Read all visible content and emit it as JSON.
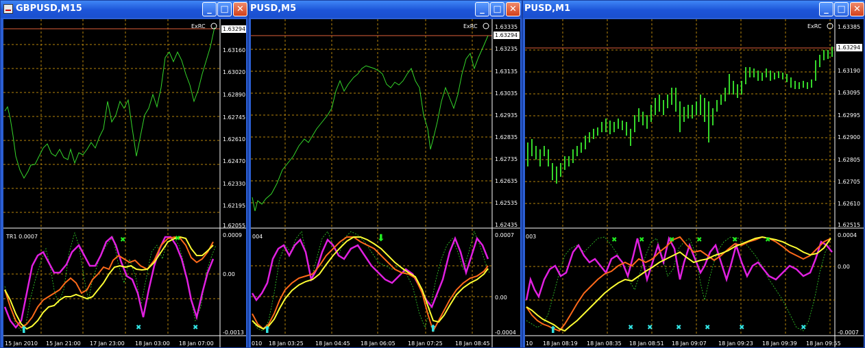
{
  "windows": [
    {
      "title": "GBPUSD,M15",
      "indicator_label": "ExRC",
      "current_price": "1.63294",
      "price_ticks": [
        "1.63294",
        "1.63160",
        "1.63020",
        "1.62890",
        "1.62745",
        "1.62610",
        "1.62470",
        "1.62330",
        "1.62195",
        "1.62055"
      ],
      "osc_name": "TR1 0.0007",
      "osc_ticks": [
        "0.0009",
        "0.00",
        "-0.0013"
      ],
      "time_ticks": [
        "15 Jan 2010",
        "15 Jan 21:00",
        "17 Jan 23:00",
        "18 Jan 03:00",
        "18 Jan 07:00"
      ]
    },
    {
      "title": "PUSD,M5",
      "indicator_label": "ExRC",
      "current_price": "1.63294",
      "price_ticks": [
        "1.63335",
        "1.63235",
        "1.63135",
        "1.63035",
        "1.62935",
        "1.62835",
        "1.62735",
        "1.62635",
        "1.62535",
        "1.62435"
      ],
      "osc_name": "004",
      "osc_ticks": [
        "0.0007",
        "0.00",
        "-0.0004"
      ],
      "time_ticks": [
        "010",
        "18 Jan 03:25",
        "18 Jan 04:45",
        "18 Jan 06:05",
        "18 Jan 07:25",
        "18 Jan 08:45"
      ]
    },
    {
      "title": "PUSD,M1",
      "indicator_label": "ExRC",
      "current_price": "1.63294",
      "price_ticks": [
        "1.63385",
        "1.63190",
        "1.63095",
        "1.62995",
        "1.62900",
        "1.62805",
        "1.62705",
        "1.62610",
        "1.62515"
      ],
      "osc_name": "003",
      "osc_ticks": [
        "0.0004",
        "0.00",
        "-0.0007"
      ],
      "time_ticks": [
        "10",
        "18 Jan 08:19",
        "18 Jan 08:35",
        "18 Jan 08:51",
        "18 Jan 09:07",
        "18 Jan 09:23",
        "18 Jan 09:39",
        "18 Jan 09:55"
      ]
    }
  ],
  "buttons": {
    "minimize": "_",
    "maximize": "□",
    "close": "✕"
  },
  "colors": {
    "price_line": "#35d62a",
    "grid": "#b8860b",
    "bid_line": "#e0603a",
    "osc_magenta": "#e020e0",
    "osc_yellow": "#ffff33",
    "osc_orange": "#ff6a1a",
    "osc_green_dash": "#35d62a",
    "cyan_arrow": "#33e5e5",
    "green_arrow": "#22ee22"
  }
}
